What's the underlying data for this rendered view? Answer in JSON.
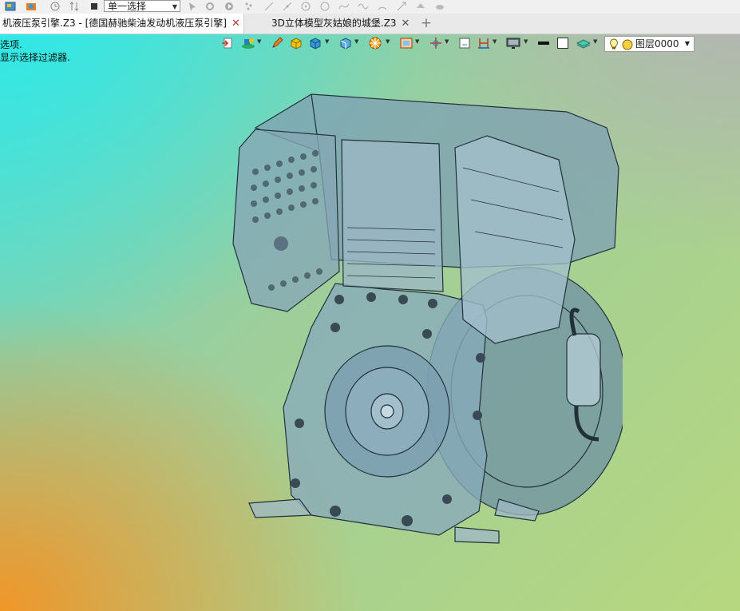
{
  "top_toolbar": {
    "selection_mode": "单一选择"
  },
  "tabs": [
    {
      "label": "机液压泵引擎.Z3 - [德国赫驰柴油发动机液压泵引擎]",
      "active": true
    },
    {
      "label": "3D立体模型灰姑娘的城堡.Z3",
      "active": false
    }
  ],
  "prompt": {
    "line1": "选项.",
    "line2": "显示选择过滤器."
  },
  "view_toolbar": {
    "icons": [
      "exit-icon",
      "render-mode-icon",
      "pencil-icon",
      "box-yellow-icon",
      "cube-blue-icon",
      "cube-view-icon",
      "color-wheel-icon",
      "view-frame-icon",
      "axis-icon",
      "doc-icon",
      "section-icon",
      "monitor-icon",
      "line-color-icon",
      "fill-color-icon",
      "layer-stack-icon"
    ],
    "layer": {
      "label": "图层0000"
    }
  },
  "colors": {
    "tab_close_active": "#c0392b",
    "engine_body": "#7fa2b2",
    "engine_edge": "#22303a"
  }
}
